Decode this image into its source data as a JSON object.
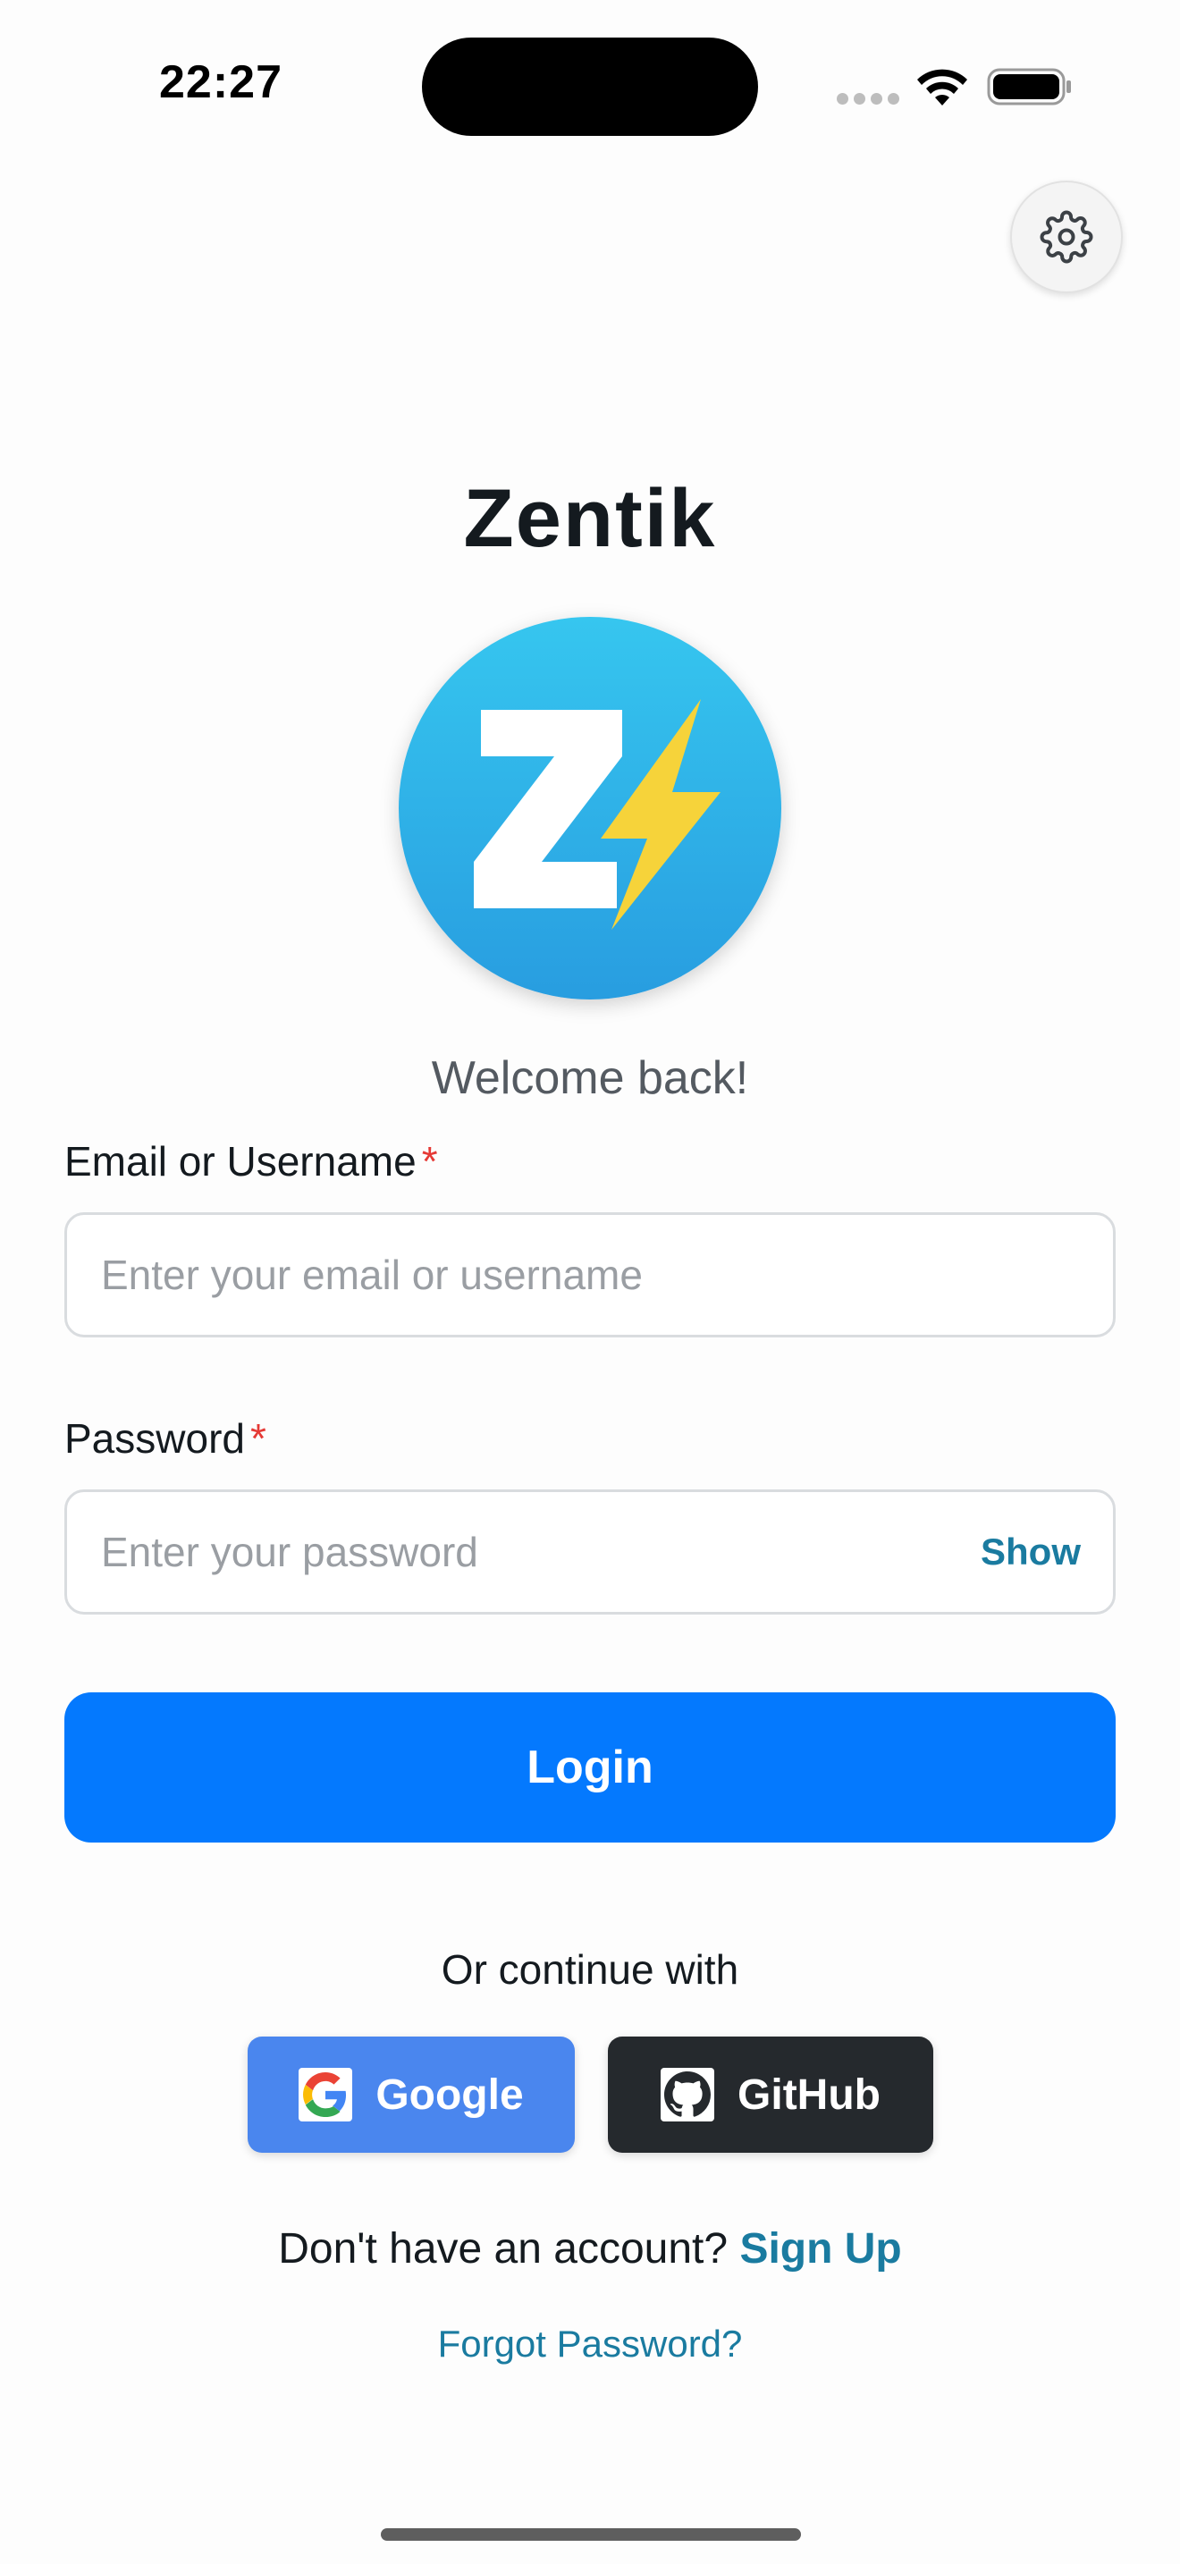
{
  "status_bar": {
    "time": "22:27",
    "icons": [
      "cellular-signal-icon",
      "wifi-icon",
      "battery-icon"
    ]
  },
  "settings": {
    "icon": "gear-icon"
  },
  "app": {
    "title": "Zentik",
    "logo_letter": "Z",
    "welcome": "Welcome back!"
  },
  "form": {
    "email": {
      "label": "Email or Username",
      "required_mark": "*",
      "placeholder": "Enter your email or username",
      "value": ""
    },
    "password": {
      "label": "Password",
      "required_mark": "*",
      "placeholder": "Enter your password",
      "value": "",
      "toggle_label": "Show"
    },
    "login_label": "Login"
  },
  "social": {
    "divider_text": "Or continue with",
    "google_label": "Google",
    "github_label": "GitHub"
  },
  "footer": {
    "signup_prompt": "Don't have an account?",
    "signup_link": "Sign Up",
    "forgot_link": "Forgot Password?"
  },
  "colors": {
    "primary": "#0479fe",
    "link": "#1a7ba0",
    "google": "#4a86ee",
    "github": "#25292d",
    "required": "#e53935",
    "logo_gradient_top": "#36c6ef",
    "logo_gradient_bottom": "#289de0",
    "bolt": "#f6d33a"
  }
}
